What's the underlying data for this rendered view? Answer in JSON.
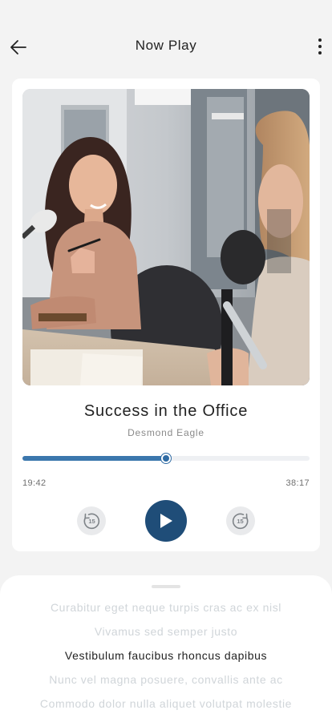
{
  "header": {
    "title": "Now Play",
    "back_icon": "arrow-left-icon",
    "menu_icon": "more-vertical-icon"
  },
  "player": {
    "artwork_icon": "podcast-cover-image",
    "title": "Success in the Office",
    "artist": "Desmond Eagle",
    "elapsed": "19:42",
    "duration": "38:17",
    "progress_fraction": 0.5,
    "skip_back_label": "15",
    "skip_forward_label": "15",
    "play_icon": "play-icon",
    "accent_color": "#1f4d78",
    "progress_color": "#3b77ad"
  },
  "lyrics": {
    "lines": [
      "Curabitur eget neque turpis cras ac ex nisl",
      "Vivamus sed semper justo",
      "Vestibulum faucibus rhoncus dapibus",
      "Nunc vel magna posuere, convallis ante ac",
      "Commodo dolor nulla aliquet volutpat molestie"
    ],
    "active_index": 2
  }
}
